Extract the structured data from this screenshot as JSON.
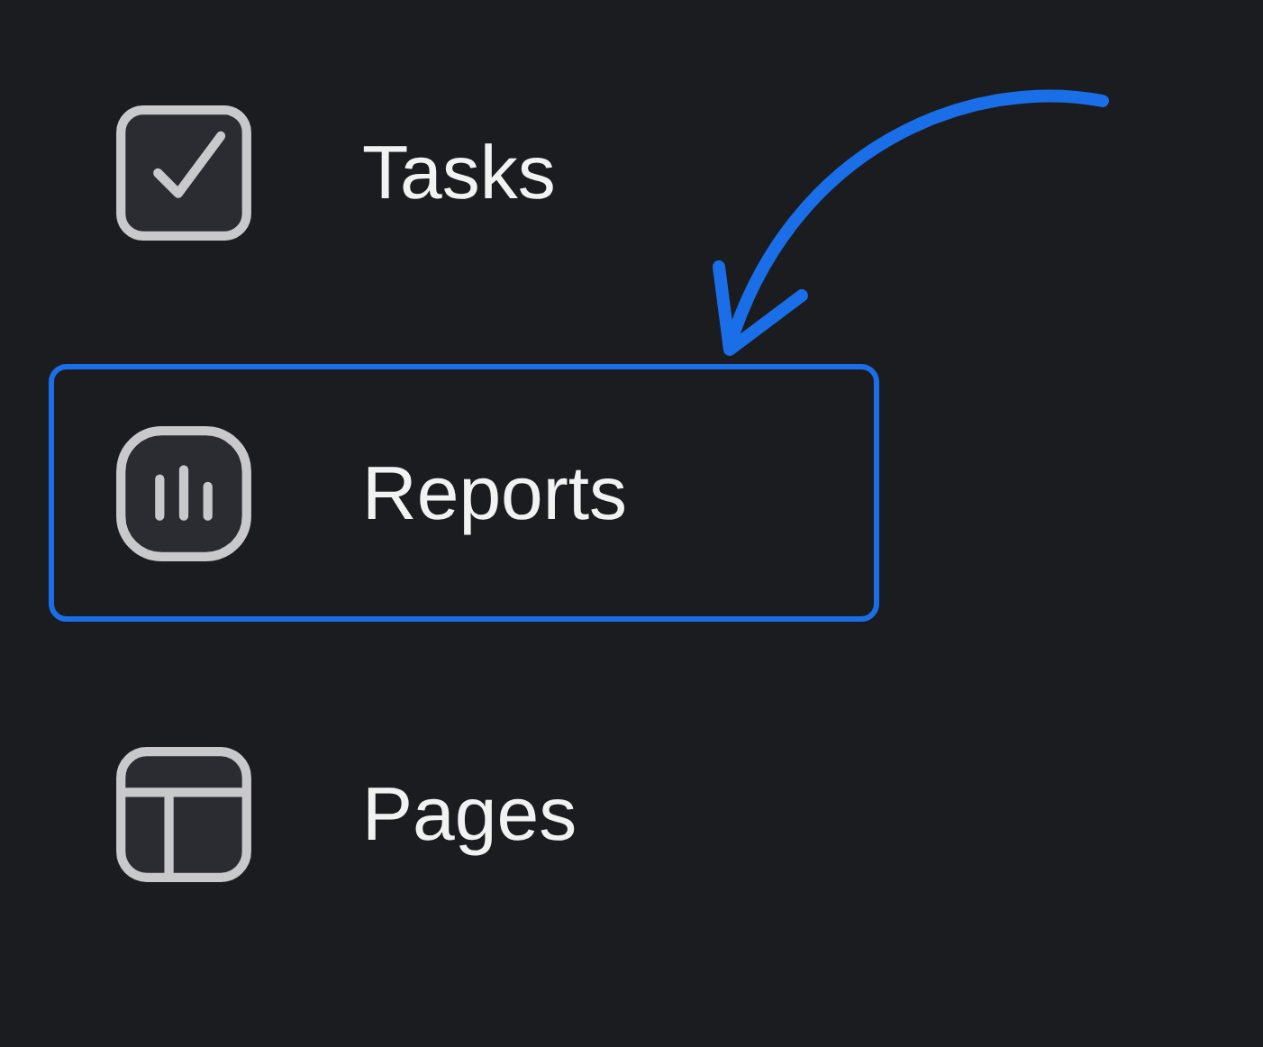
{
  "nav_items": [
    {
      "label": "Tasks",
      "kind": "tasks",
      "selected": false
    },
    {
      "label": "Reports",
      "kind": "reports",
      "selected": true
    },
    {
      "label": "Pages",
      "kind": "pages",
      "selected": false
    }
  ]
}
